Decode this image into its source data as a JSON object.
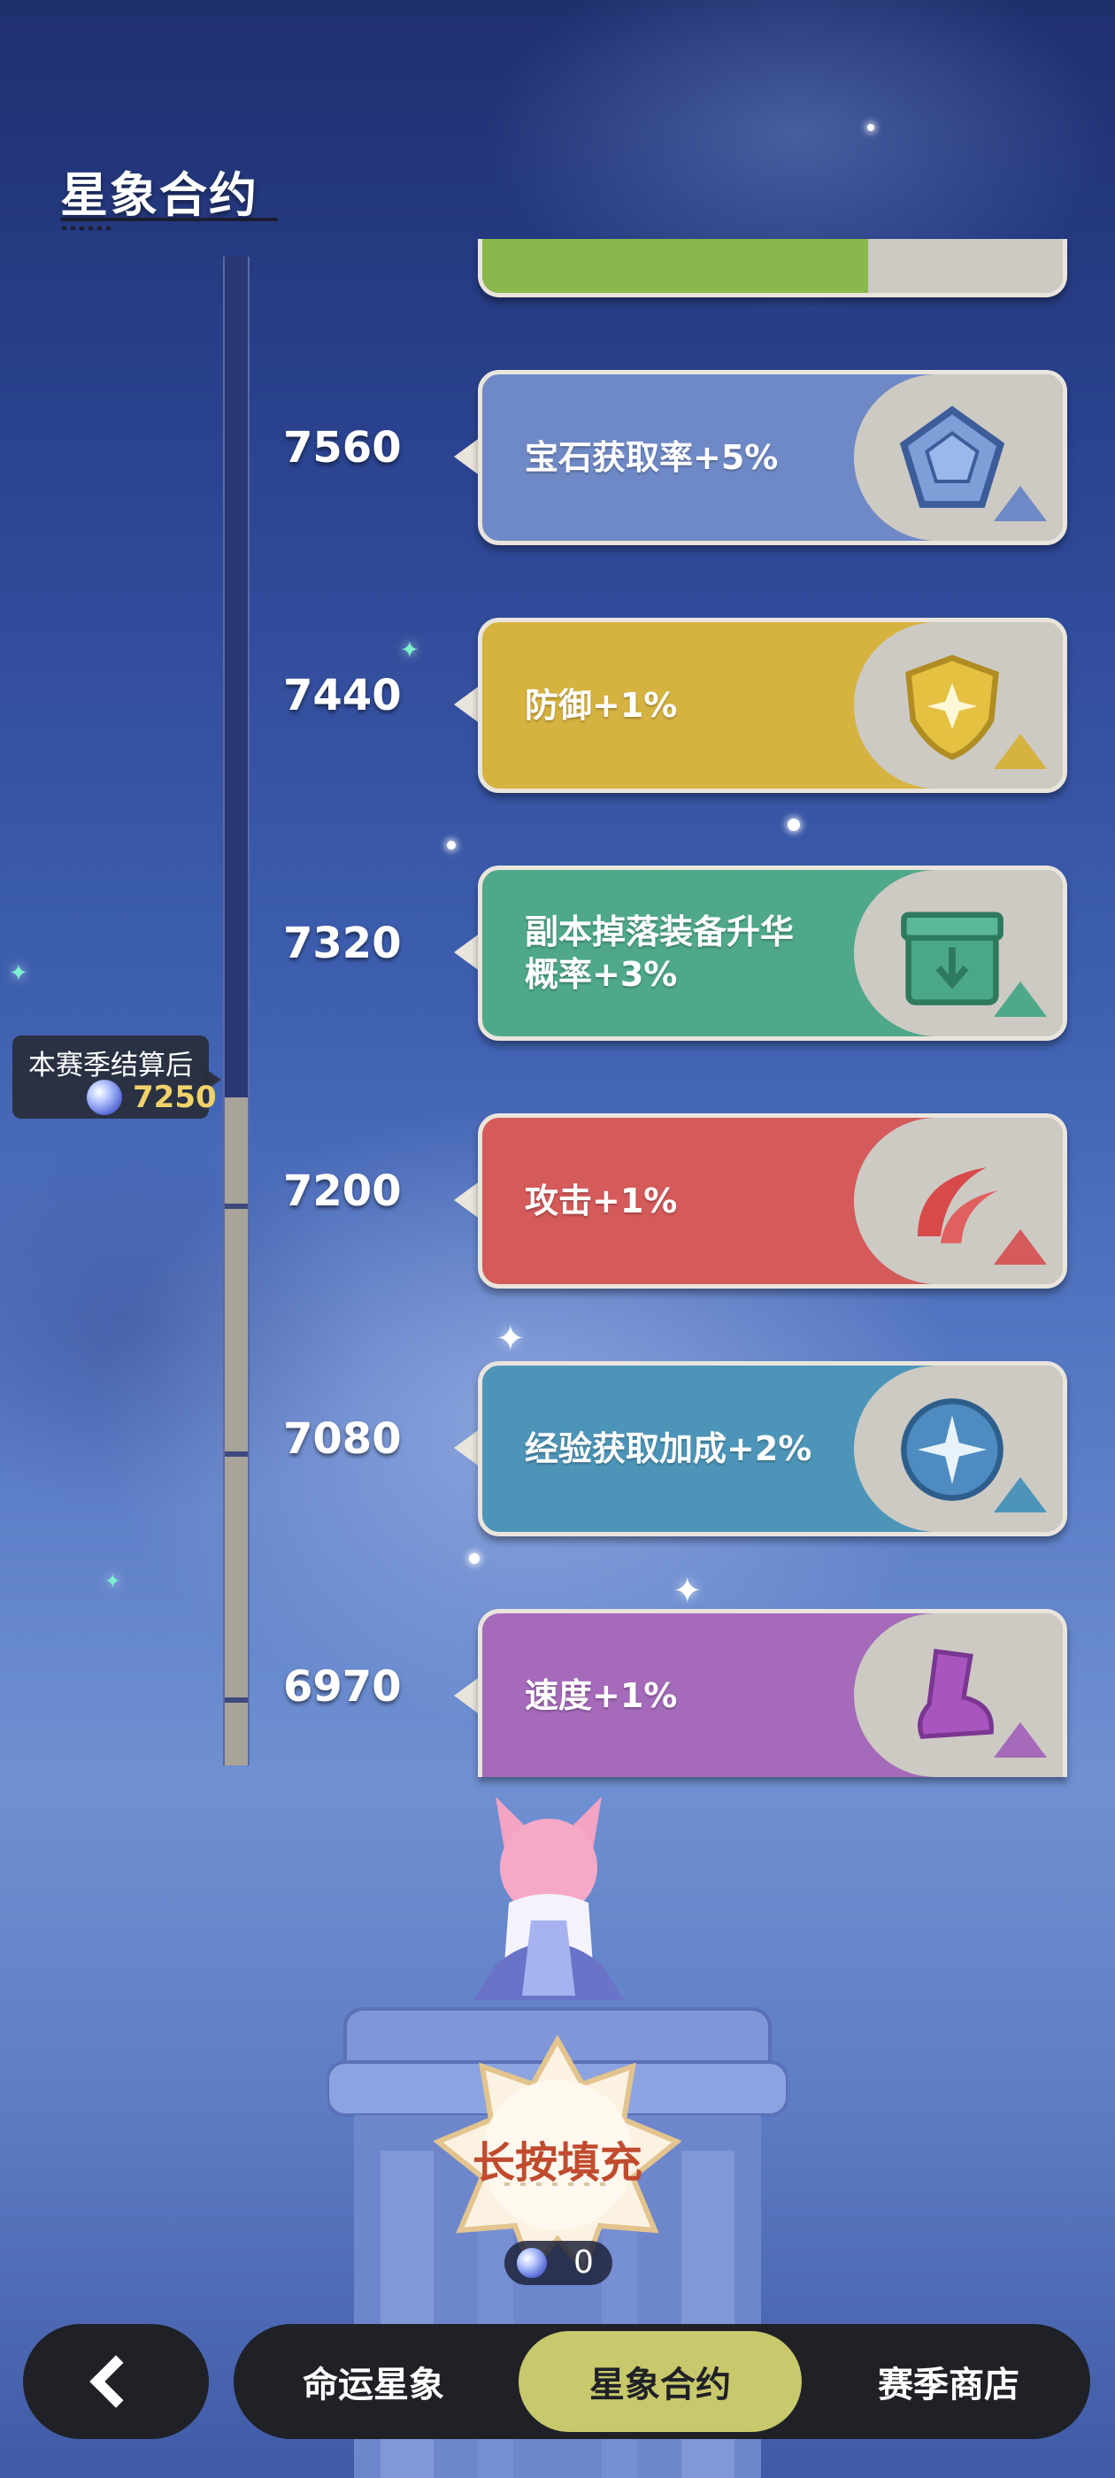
{
  "header": {
    "title": "星象合约"
  },
  "progress": {
    "label": "本赛季结算后",
    "value": "7250"
  },
  "levels": [
    {
      "score": "7560",
      "reward": "宝石获取率+5%",
      "icon": "gem-icon",
      "color": "#6f89c6"
    },
    {
      "score": "7440",
      "reward": "防御+1%",
      "icon": "shield-icon",
      "color": "#d6b240"
    },
    {
      "score": "7320",
      "reward": "副本掉落装备升华\n概率+3%",
      "icon": "box-icon",
      "color": "#4fa88a"
    },
    {
      "score": "7200",
      "reward": "攻击+1%",
      "icon": "slash-icon",
      "color": "#d55a5a"
    },
    {
      "score": "7080",
      "reward": "经验获取加成+2%",
      "icon": "exp-orb-icon",
      "color": "#4d95b8"
    },
    {
      "score": "6970",
      "reward": "速度+1%",
      "icon": "boot-icon",
      "color": "#a56ab9"
    }
  ],
  "fill": {
    "label": "长按填充",
    "cost": "0"
  },
  "nav": {
    "back_icon": "chevron-left-icon",
    "tabs": [
      {
        "label": "命运星象",
        "active": false
      },
      {
        "label": "星象合约",
        "active": true
      },
      {
        "label": "赛季商店",
        "active": false
      }
    ]
  }
}
